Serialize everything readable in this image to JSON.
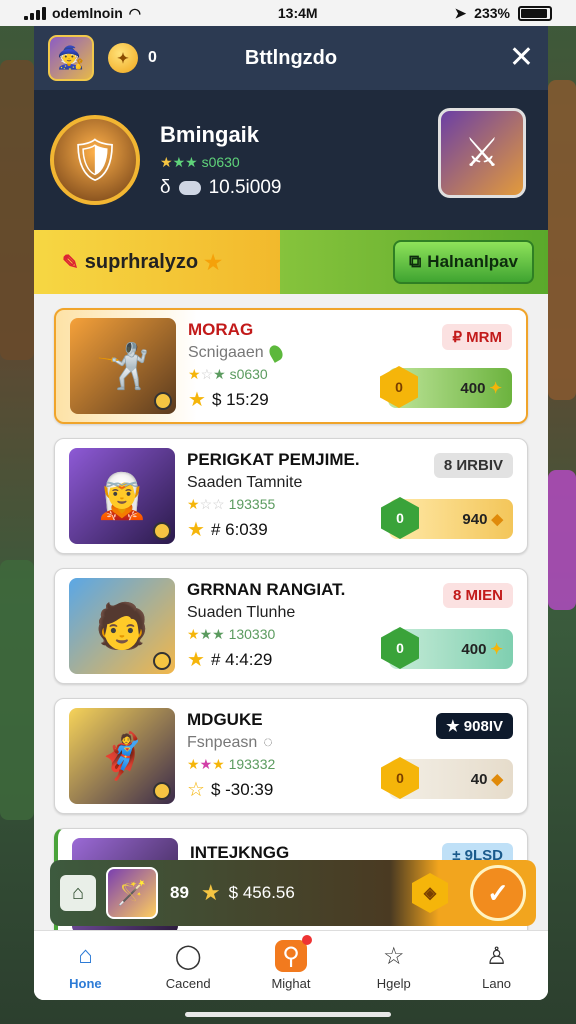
{
  "status": {
    "carrier": "odemlnoin",
    "time": "13:4M",
    "battery": "233%"
  },
  "header": {
    "coin_count": "0",
    "title": "Bttlngzdo",
    "close": "✕"
  },
  "profile": {
    "name": "Bmingaik",
    "stars_text": "s0630",
    "score": "10.5i009"
  },
  "banner": {
    "left_label": "suprhralyzo",
    "button_label": "Halnanlpav"
  },
  "cards": [
    {
      "name": "MORAG",
      "sub": "Scnigaaen",
      "stars_text": "s0630",
      "price": "$ 15:29",
      "badge": "₽ MRM",
      "cta": "400",
      "hex": "0"
    },
    {
      "name": "PERIGKAT PEMJIME.",
      "sub": "Saaden Tamnite",
      "stars_text": "193355",
      "price": "# 6:039",
      "badge": "8 ИRBIV",
      "cta": "940",
      "hex": "0"
    },
    {
      "name": "GRRNAN RANGIAT.",
      "sub": "Suaden Tlunhe",
      "stars_text": "130330",
      "price": "# 4:4:29",
      "badge": "8 MIEN",
      "cta": "400",
      "hex": "0"
    },
    {
      "name": "MDGUKE",
      "sub": "Fsnpeasn",
      "stars_text": "193332",
      "price": "$ -30:39",
      "badge": "★ 908IV",
      "cta": "40",
      "hex": "0"
    },
    {
      "name": "INTEJKNGG",
      "sub": "",
      "stars_text": "",
      "price": "",
      "badge": "± 9LSD",
      "cta": "",
      "hex": ""
    }
  ],
  "floatbar": {
    "count": "89",
    "price": "$ 456.56"
  },
  "nav": [
    {
      "label": "Hone"
    },
    {
      "label": "Cacend"
    },
    {
      "label": "Mighat"
    },
    {
      "label": "Hgelp"
    },
    {
      "label": "Lano"
    }
  ],
  "colors": {
    "accent": "#2d7bd6",
    "highlight": "#f0a42a",
    "green": "#5aa92b",
    "dark_header": "#2c3a52"
  }
}
